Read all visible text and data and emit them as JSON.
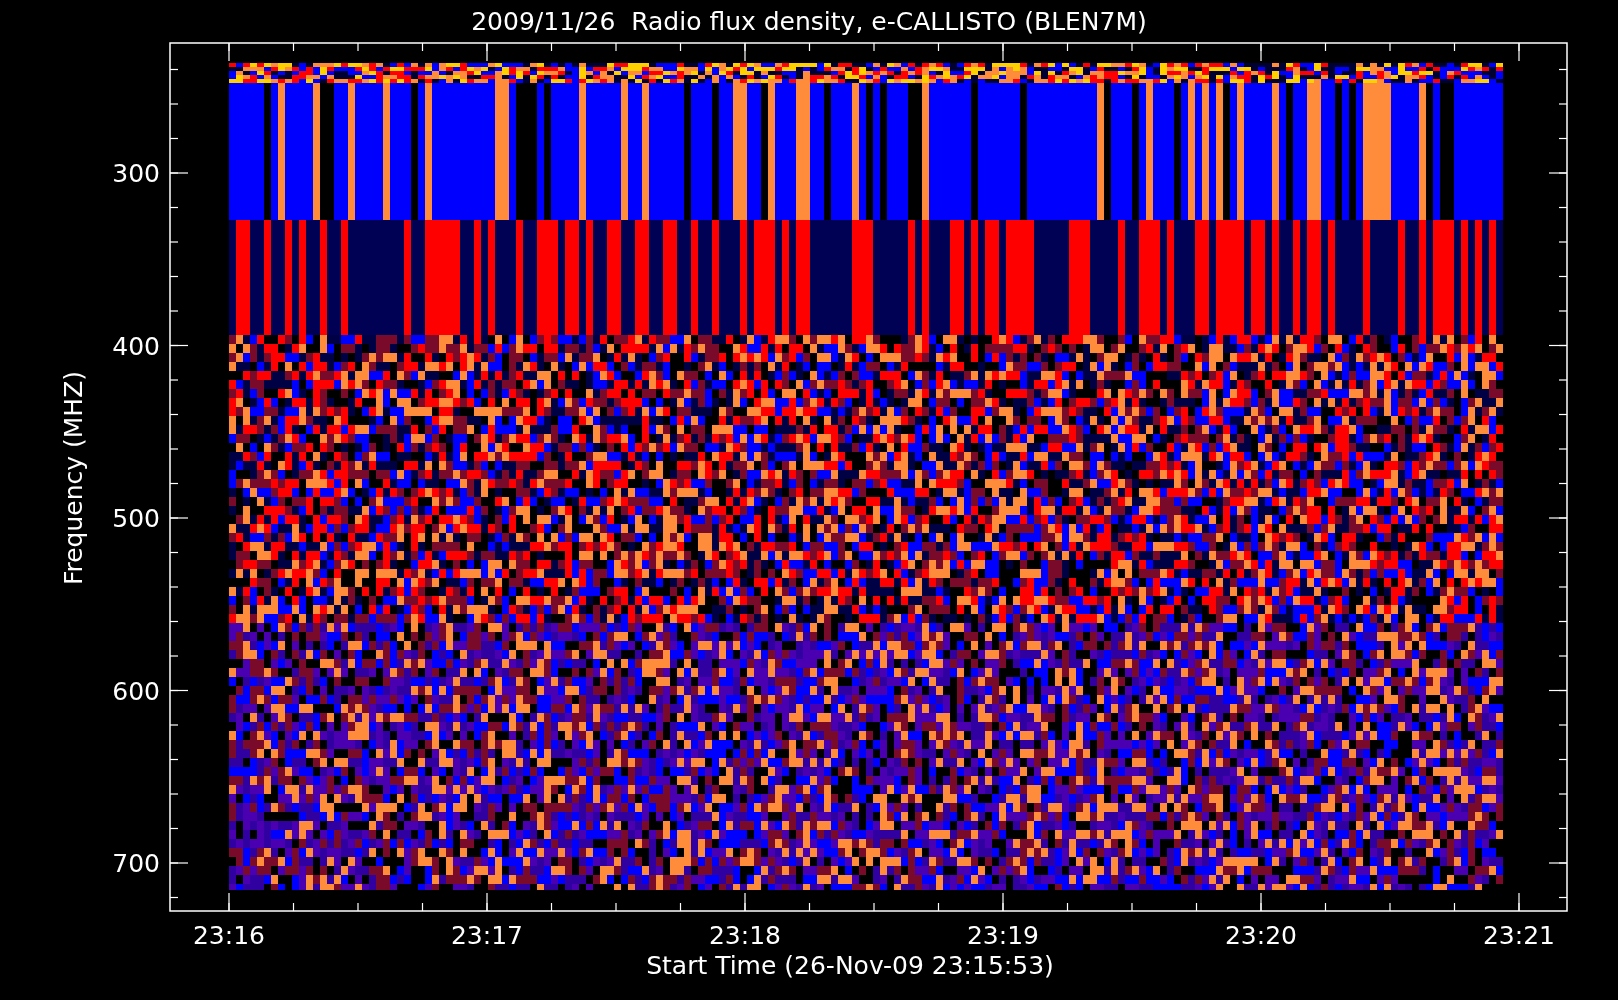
{
  "title": "2009/11/26  Radio flux density, e-CALLISTO (BLEN7M)",
  "y_axis": {
    "label": "Frequency (MHZ)",
    "ticks": [
      "300",
      "400",
      "500",
      "600",
      "700"
    ]
  },
  "x_axis": {
    "label": "Start Time (26-Nov-09 23:15:53)",
    "ticks": [
      "23:16",
      "23:17",
      "23:18",
      "23:19",
      "23:20",
      "23:21"
    ]
  }
}
